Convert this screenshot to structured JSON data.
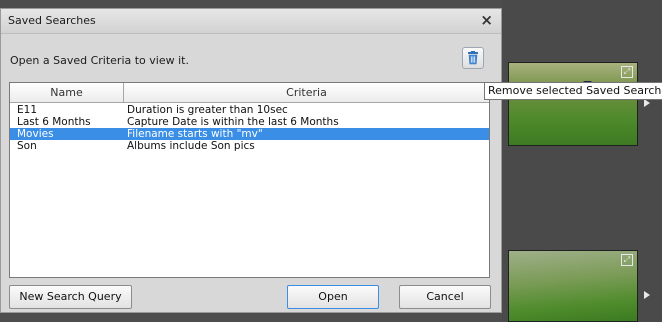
{
  "dialog": {
    "title": "Saved Searches",
    "close_label": "×",
    "instruction": "Open a Saved Criteria to view it.",
    "table": {
      "headers": [
        "Name",
        "Criteria"
      ],
      "rows": [
        {
          "name": "E11",
          "criteria": "Duration is greater than 10sec",
          "selected": false
        },
        {
          "name": "Last 6 Months",
          "criteria": "Capture Date is within the last 6 Months",
          "selected": false
        },
        {
          "name": "Movies",
          "criteria": "Filename starts with \"mv\"",
          "selected": true
        },
        {
          "name": "Son",
          "criteria": "Albums include Son pics",
          "selected": false
        }
      ]
    },
    "buttons": {
      "new_query": "New Search Query",
      "open": "Open",
      "cancel": "Cancel"
    }
  },
  "tooltip": "Remove selected Saved Search",
  "icons": {
    "remove": "trash-icon",
    "close": "close-icon",
    "play": "play-icon",
    "expand": "expand-icon"
  },
  "colors": {
    "selection": "#3a8ee6",
    "dialog_bg": "#d8d8d8",
    "app_bg": "#4d4d4d"
  }
}
